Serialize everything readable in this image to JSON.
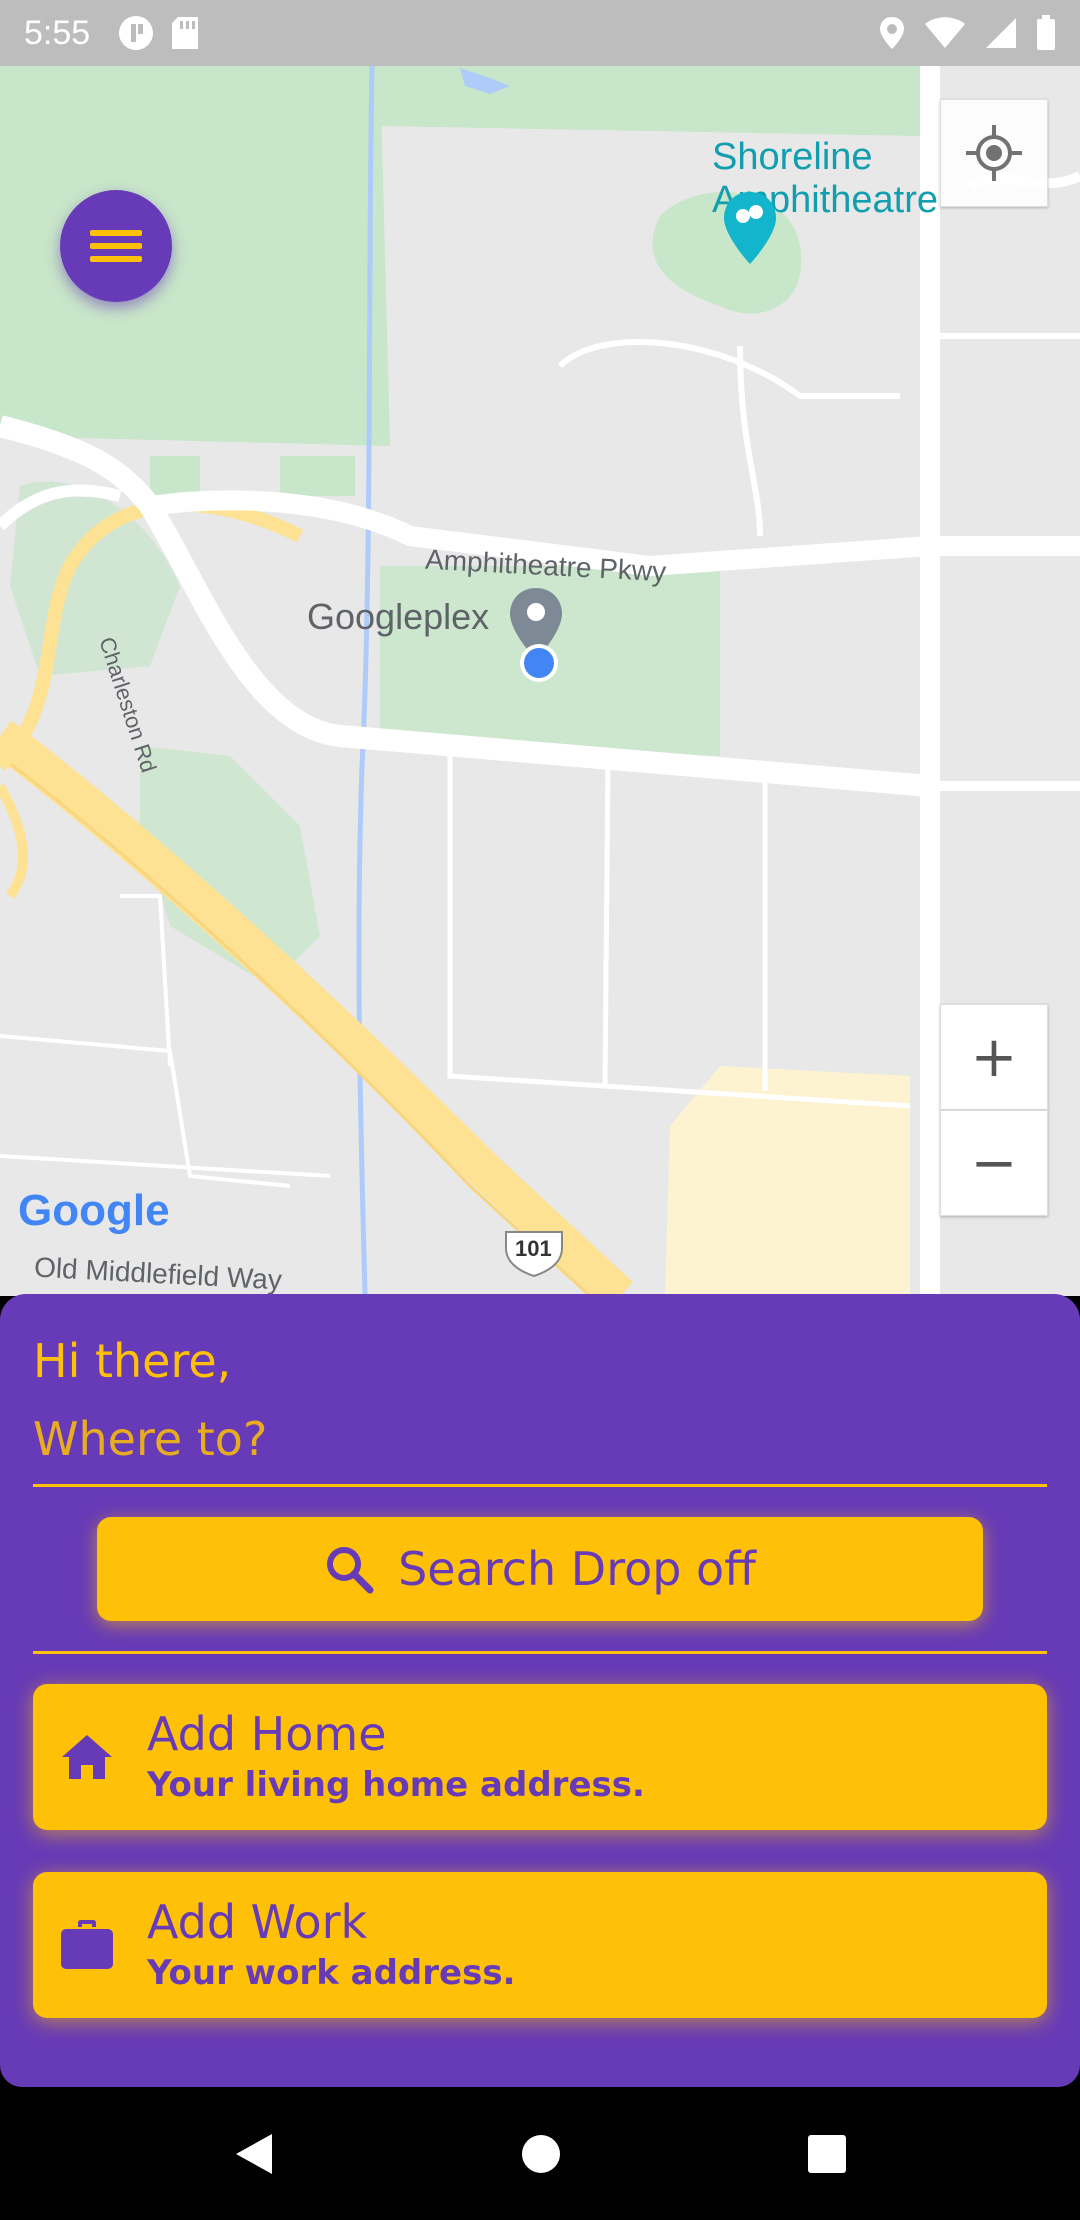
{
  "status_bar": {
    "time": "5:55",
    "left_icons": [
      "notification-icon",
      "sd-card-icon"
    ],
    "right_icons": [
      "location-icon",
      "wifi-icon",
      "signal-icon",
      "battery-icon"
    ]
  },
  "map": {
    "labels": {
      "shoreline": "Shoreline Amphitheatre",
      "amphitheatre_pkwy": "Amphitheatre Pkwy",
      "googleplex": "Googleplex",
      "charleston_rd": "Charleston Rd",
      "old_middlefield": "Old Middlefield Way",
      "highway": "101",
      "google_logo": "Google"
    },
    "controls": {
      "zoom_in": "+",
      "zoom_out": "−"
    }
  },
  "sheet": {
    "greeting": "Hi there,",
    "where_placeholder": "Where to?",
    "where_value": "",
    "search_label": "Search Drop off",
    "home": {
      "title": "Add Home",
      "subtitle": "Your living home address."
    },
    "work": {
      "title": "Add Work",
      "subtitle": "Your work address."
    }
  },
  "colors": {
    "primary": "#673ab7",
    "accent": "#ffc107",
    "map_bg": "#e8e8e8",
    "park": "#c8e6c9",
    "highway": "#fde293"
  }
}
